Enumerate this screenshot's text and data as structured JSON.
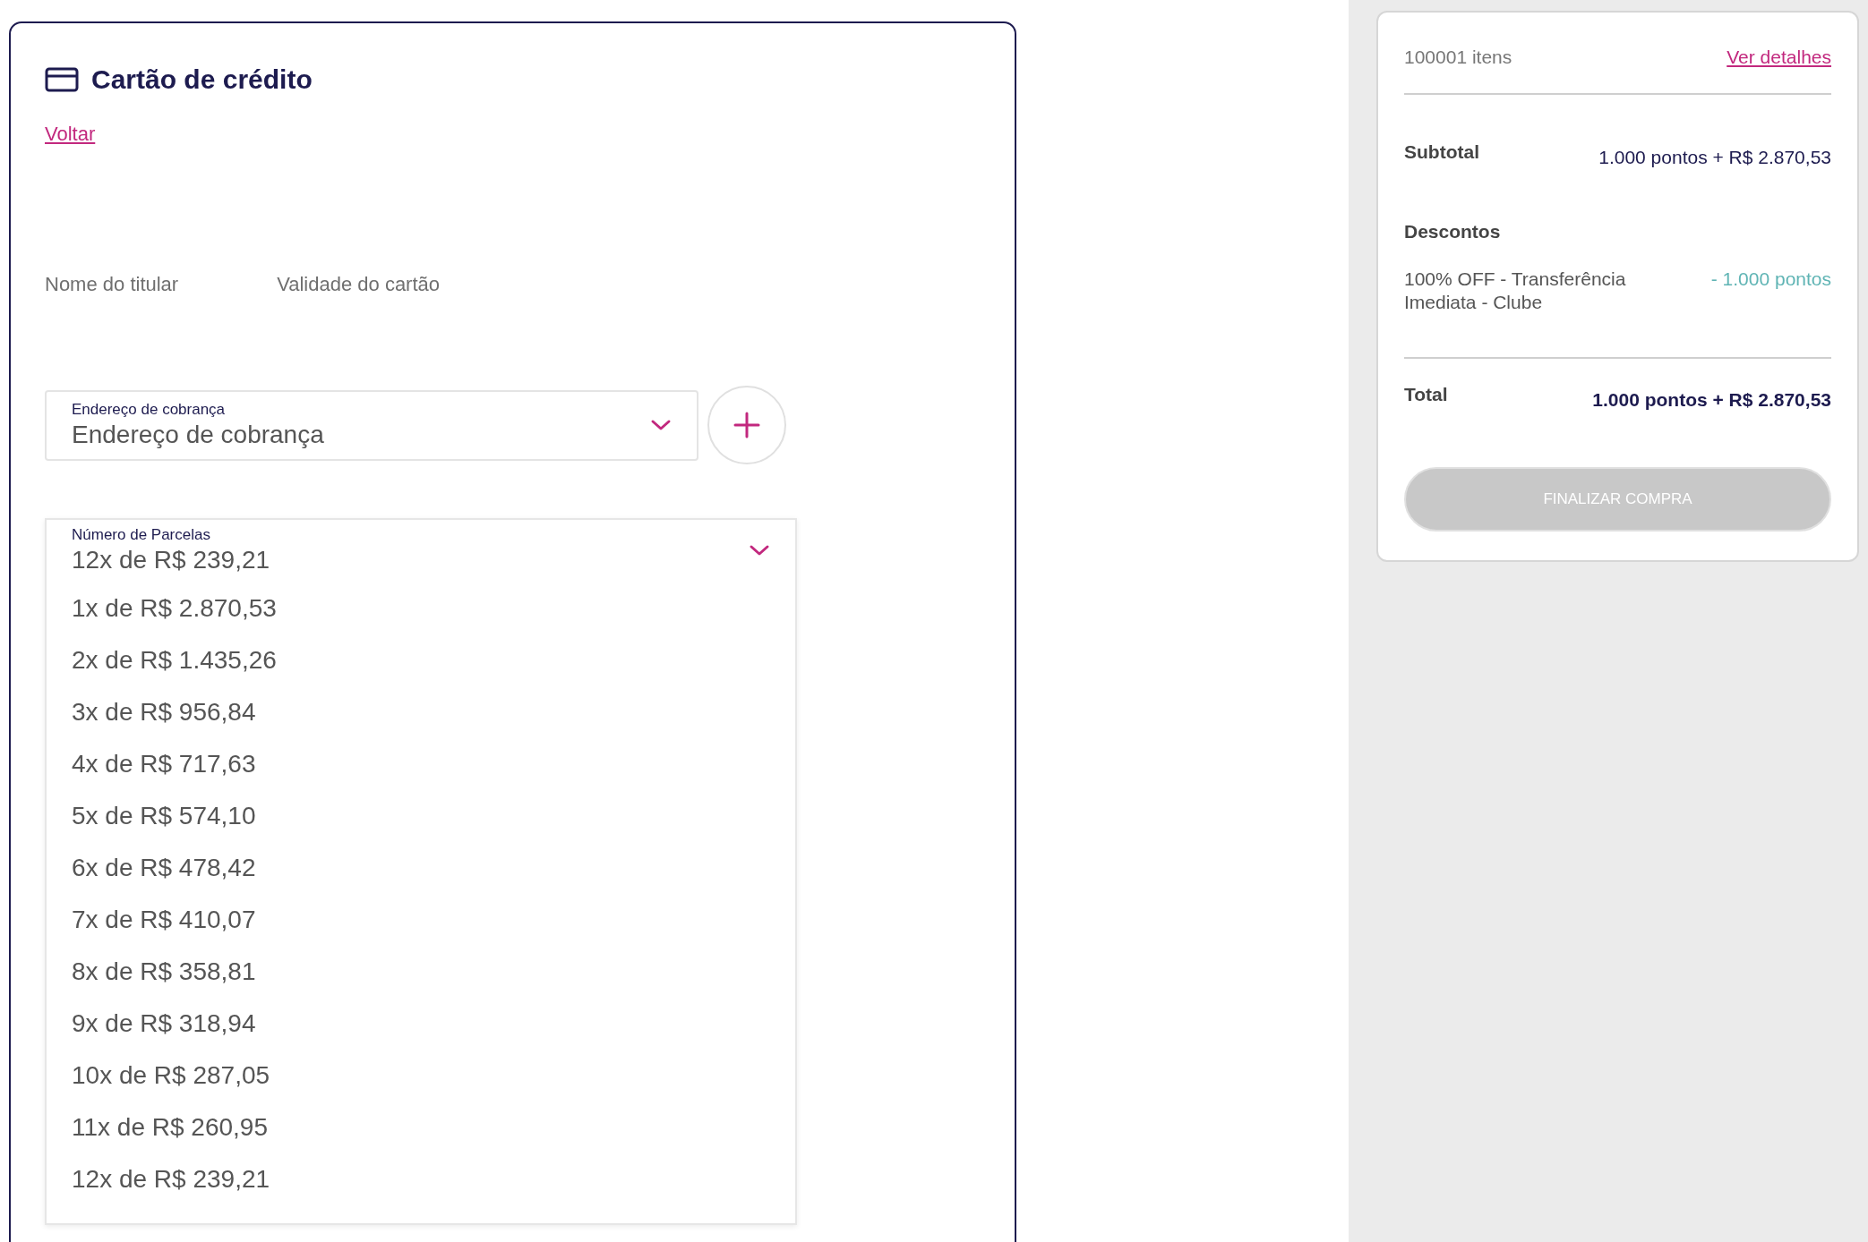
{
  "payment_card": {
    "title": "Cartão de crédito",
    "back_link": "Voltar",
    "field_labels": [
      "Nome do titular",
      "Validade do cartão"
    ],
    "billing_address": {
      "label": "Endereço de cobrança",
      "value": "Endereço de cobrança"
    },
    "installments": {
      "label": "Número de Parcelas",
      "value": "12x de R$ 239,21",
      "expanded": true,
      "options": [
        {
          "label": "1x de R$ 2.870,53"
        },
        {
          "label": "2x de R$ 1.435,26"
        },
        {
          "label": "3x de R$ 956,84"
        },
        {
          "label": "4x de R$ 717,63"
        },
        {
          "label": "5x de R$ 574,10"
        },
        {
          "label": "6x de R$ 478,42"
        },
        {
          "label": "7x de R$ 410,07"
        },
        {
          "label": "8x de R$ 358,81"
        },
        {
          "label": "9x de R$ 318,94"
        },
        {
          "label": "10x de R$ 287,05"
        },
        {
          "label": "11x de R$ 260,95"
        },
        {
          "label": "12x de R$ 239,21"
        }
      ]
    }
  },
  "summary": {
    "item_count": "100001 itens",
    "details_link": "Ver detalhes",
    "subtotal_label": "Subtotal",
    "subtotal_value": "1.000 pontos + R$ 2.870,53",
    "discounts_label": "Descontos",
    "discounts": [
      {
        "name": "100% OFF - Transferência Imediata - Clube",
        "value": "- 1.000 pontos"
      }
    ],
    "total_label": "Total",
    "total_value": "1.000 pontos + R$ 2.870,53",
    "checkout_button": {
      "label": "FINALIZAR COMPRA",
      "disabled": true
    }
  }
}
